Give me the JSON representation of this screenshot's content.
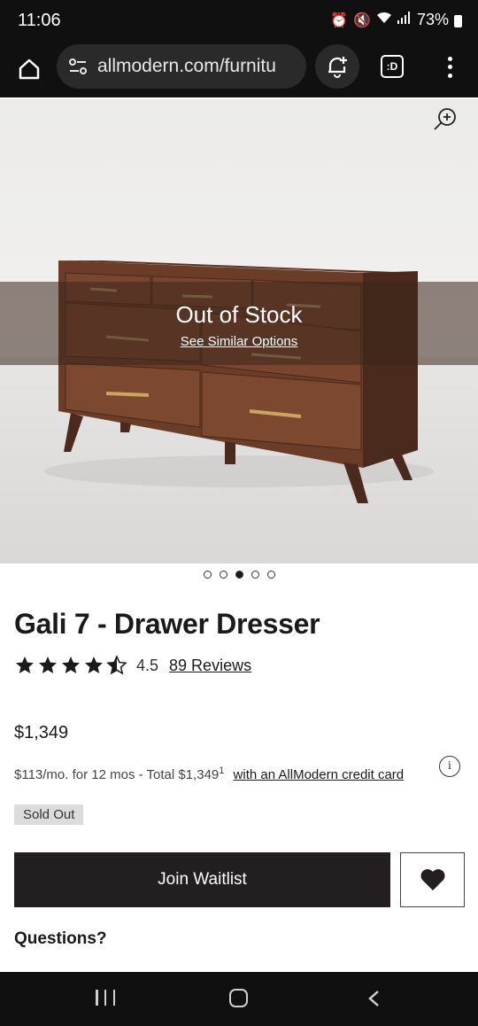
{
  "status": {
    "time": "11:06",
    "battery": "73%"
  },
  "browser": {
    "url": "allmodern.com/furnitu",
    "tabs_label": ":D"
  },
  "hero": {
    "overlay_title": "Out of Stock",
    "overlay_link": "See Similar Options",
    "image_count": 5,
    "active_image": 3
  },
  "product": {
    "title": "Gali 7 - Drawer Dresser",
    "rating": "4.5",
    "rating_value": 4.5,
    "reviews": "89 Reviews",
    "price": "$1,349",
    "financing_text": "$113/mo. for 12 mos - Total $1,349",
    "financing_sup": "1",
    "financing_link": "with an AllModern credit card",
    "info_glyph": "i",
    "badge": "Sold Out",
    "waitlist_label": "Join Waitlist",
    "questions": "Questions?"
  },
  "icons": [
    "home-icon",
    "tune-icon",
    "notification-add-icon",
    "tabs-icon",
    "more-vert-icon",
    "zoom-in-icon",
    "star-icon",
    "heart-icon",
    "info-icon",
    "recents-icon",
    "home-nav-icon",
    "back-icon"
  ]
}
